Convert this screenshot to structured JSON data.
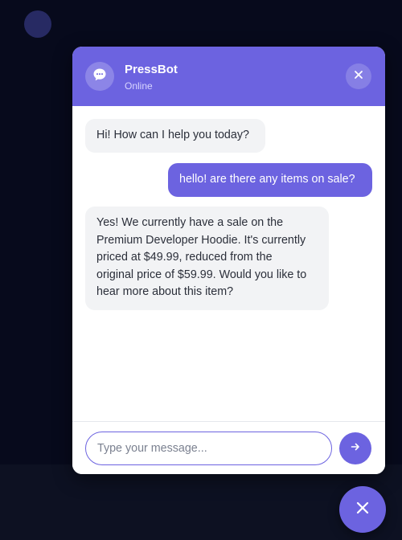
{
  "header": {
    "bot_name": "PressBot",
    "status": "Online",
    "avatar_icon": "chat-bubble-icon",
    "close_icon": "close-icon"
  },
  "messages": [
    {
      "sender": "bot",
      "text": "Hi! How can I help you today?"
    },
    {
      "sender": "user",
      "text": "hello! are there any items on sale?"
    },
    {
      "sender": "bot",
      "text": "Yes! We currently have a sale on the\nPremium Developer Hoodie. It's currently\npriced at $49.99, reduced from the\noriginal price of $59.99. Would you like to\nhear more about this item?"
    }
  ],
  "input": {
    "placeholder": "Type your message...",
    "value": ""
  },
  "send_icon": "arrow-right-icon",
  "launcher_icon": "close-icon",
  "colors": {
    "accent": "#6c63e0",
    "background": "#070a1c",
    "bot_bubble": "#f2f3f5"
  }
}
